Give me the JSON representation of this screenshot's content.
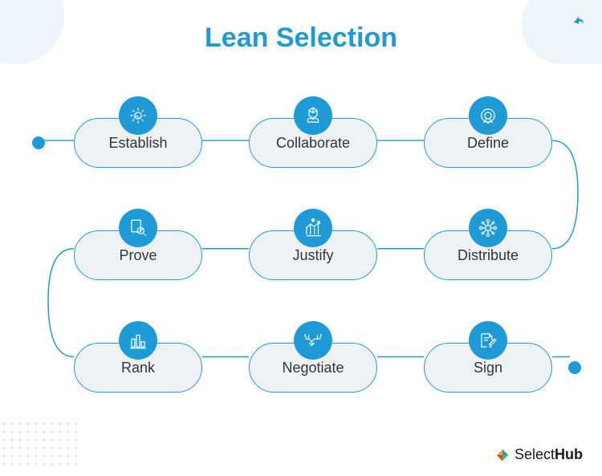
{
  "title": "Lean Selection",
  "steps": [
    {
      "label": "Establish",
      "icon": "gear"
    },
    {
      "label": "Collaborate",
      "icon": "hands"
    },
    {
      "label": "Define",
      "icon": "target"
    },
    {
      "label": "Distribute",
      "icon": "network"
    },
    {
      "label": "Justify",
      "icon": "chart-up"
    },
    {
      "label": "Prove",
      "icon": "search-doc"
    },
    {
      "label": "Rank",
      "icon": "bars"
    },
    {
      "label": "Negotiate",
      "icon": "handshake"
    },
    {
      "label": "Sign",
      "icon": "doc-pen"
    }
  ],
  "brand": {
    "name_part1": "Select",
    "name_part2": "Hub"
  },
  "colors": {
    "primary": "#1e9bd7",
    "node_bg": "#eff2f5",
    "text": "#333333"
  }
}
